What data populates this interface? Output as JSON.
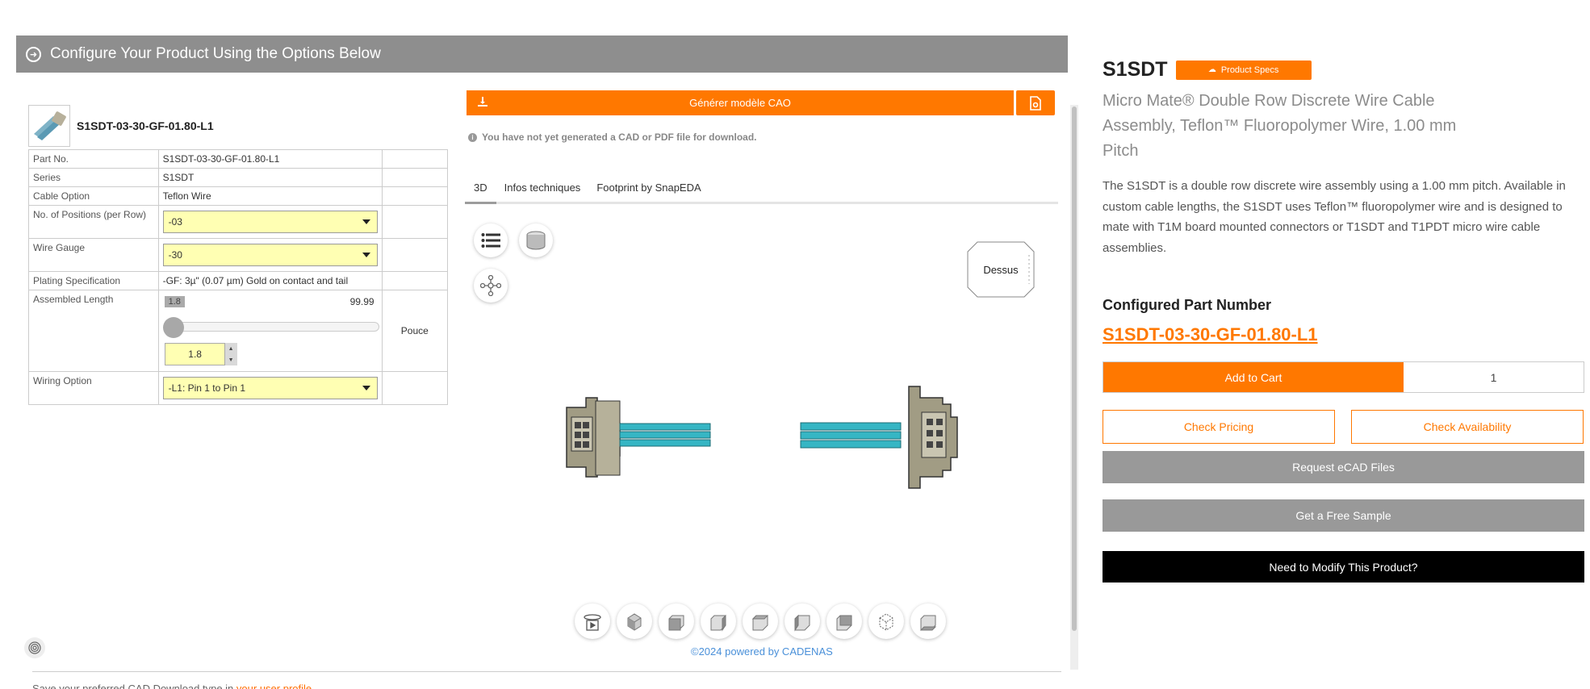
{
  "configurator": {
    "banner_title": "Configure Your Product Using the Options Below",
    "part_number": "S1SDT-03-30-GF-01.80-L1",
    "rows": [
      {
        "label": "Part No.",
        "value": "S1SDT-03-30-GF-01.80-L1"
      },
      {
        "label": "Series",
        "value": "S1SDT"
      },
      {
        "label": "Cable Option",
        "value": "Teflon Wire"
      },
      {
        "label": "No. of Positions (per Row)",
        "value": "-03"
      },
      {
        "label": "Wire Gauge",
        "value": "-30"
      },
      {
        "label": "Plating Specification",
        "value": "-GF: 3µ\" (0.07 µm) Gold on contact and tail"
      },
      {
        "label": "Assembled Length",
        "min": "1.8",
        "max": "99.99",
        "input_value": "1.8",
        "unit": "Pouce"
      },
      {
        "label": "Wiring Option",
        "value": "-L1: Pin 1 to Pin 1"
      }
    ],
    "slider_level": 0.0
  },
  "cad": {
    "generate_label": "Générer modèle CAO",
    "note": "You have not yet generated a CAD or PDF file for download.",
    "tabs": [
      "3D",
      "Infos techniques",
      "Footprint by SnapEDA"
    ],
    "active_tab": "3D",
    "viewcube_label": "Dessus",
    "powered_by": "©2024 powered by CADENAS",
    "view_buttons": [
      "rotate-play-icon",
      "iso-view-icon",
      "front-view-icon",
      "right-view-icon",
      "top-view-icon",
      "left-view-icon",
      "back-view-icon",
      "wireframe-view-icon",
      "bottom-view-icon"
    ]
  },
  "product": {
    "title": "S1SDT",
    "specs_badge": "Product Specs",
    "subtitle": "Micro Mate® Double Row Discrete Wire Cable Assembly, Teflon™ Fluoropolymer Wire, 1.00 mm Pitch",
    "description": "The S1SDT is a double row discrete wire assembly using a 1.00 mm pitch. Available in custom cable lengths, the S1SDT uses Teflon™ fluoropolymer wire and is designed to mate with T1M board mounted connectors or T1SDT and T1PDT micro wire cable assemblies.",
    "configured_label": "Configured Part Number",
    "configured_pn": "S1SDT-03-30-GF-01.80-L1",
    "add_to_cart": "Add to Cart",
    "quantity": "1",
    "check_pricing": "Check Pricing",
    "check_availability": "Check Availability",
    "request_ecad": "Request eCAD Files",
    "free_sample": "Get a Free Sample",
    "modify": "Need to Modify This Product?"
  },
  "footer": {
    "note_prefix": "Save your preferred CAD Download type in",
    "note_link": "your user profile"
  },
  "colors": {
    "accent": "#ff7800",
    "banner": "#8e8e8e",
    "select_bg": "#ffffb3"
  }
}
